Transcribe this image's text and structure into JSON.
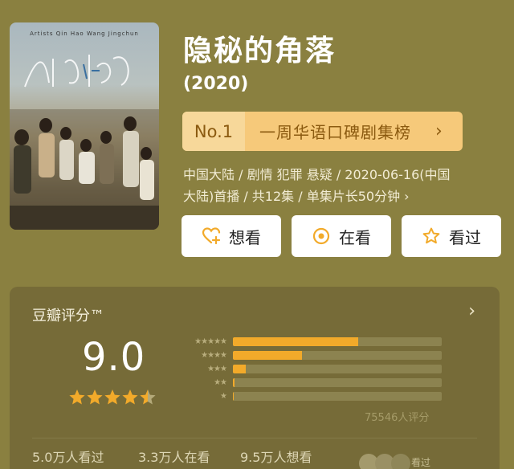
{
  "poster": {
    "credits": "Artists  Qin Hao  Wang Jingchun"
  },
  "movie": {
    "title": "隐秘的角落",
    "year": "(2020)"
  },
  "rank": {
    "no": "No.1",
    "chart": "一周华语口碑剧集榜",
    "arrow": "›"
  },
  "meta": {
    "line1": "中国大陆 / 剧情 犯罪 悬疑 / 2020-06-16(中国",
    "line2": "大陆)首播 / 共12集 / 单集片长50分钟 ›"
  },
  "buttons": {
    "want": "想看",
    "watching": "在看",
    "watched": "看过"
  },
  "rating": {
    "label": "豆瓣评分™",
    "more": "›",
    "score": "9.0",
    "stars": 4.5,
    "star_labels": [
      "★★★★★",
      "★★★★",
      "★★★",
      "★★",
      "★"
    ],
    "distribution": [
      0.6,
      0.33,
      0.06,
      0.008,
      0.003
    ],
    "count": "75546人评分",
    "seen": "5.0万人看过",
    "watching": "3.3万人在看",
    "want": "9.5万人想看",
    "watch_text": "看过"
  },
  "colors": {
    "background": "#8a8040",
    "accent": "#f2aa2a",
    "rank_bg": "#f6c97a"
  }
}
